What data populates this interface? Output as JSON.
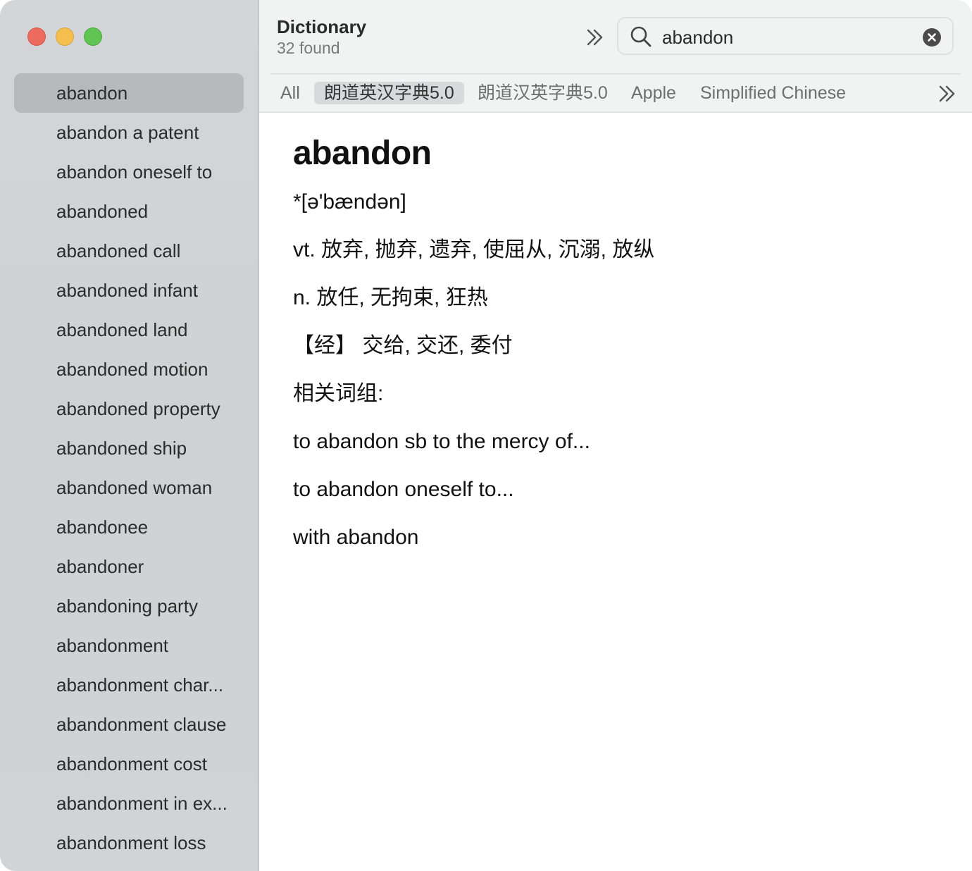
{
  "window": {
    "title": "Dictionary",
    "subtitle": "32 found"
  },
  "search": {
    "value": "abandon",
    "placeholder": ""
  },
  "sidebar": {
    "results": [
      "abandon",
      "abandon a patent",
      "abandon oneself to",
      "abandoned",
      "abandoned call",
      "abandoned infant",
      "abandoned land",
      "abandoned motion",
      "abandoned property",
      "abandoned ship",
      "abandoned woman",
      "abandonee",
      "abandoner",
      "abandoning party",
      "abandonment",
      "abandonment char...",
      "abandonment clause",
      "abandonment cost",
      "abandonment in ex...",
      "abandonment loss"
    ],
    "selected_index": 0
  },
  "tabs": [
    "All",
    "朗道英汉字典5.0",
    "朗道汉英字典5.0",
    "Apple",
    "Simplified Chinese"
  ],
  "active_tab_index": 1,
  "entry": {
    "headword": "abandon",
    "lines": [
      "*[ə'bændən]",
      "vt. 放弃, 抛弃, 遗弃, 使屈从, 沉溺, 放纵",
      "n. 放任, 无拘束, 狂热",
      "【经】 交给, 交还, 委付",
      "相关词组:",
      "to abandon sb to the mercy of...",
      "to abandon oneself to...",
      "with abandon"
    ]
  },
  "icons": {
    "more": "chevron-double-right-icon",
    "search": "magnifier-icon",
    "clear": "clear-circle-icon"
  },
  "colors": {
    "close": "#ed6a5e",
    "minimize": "#f5bf4f",
    "zoom": "#61c554",
    "selection": "#b8b9bc"
  }
}
